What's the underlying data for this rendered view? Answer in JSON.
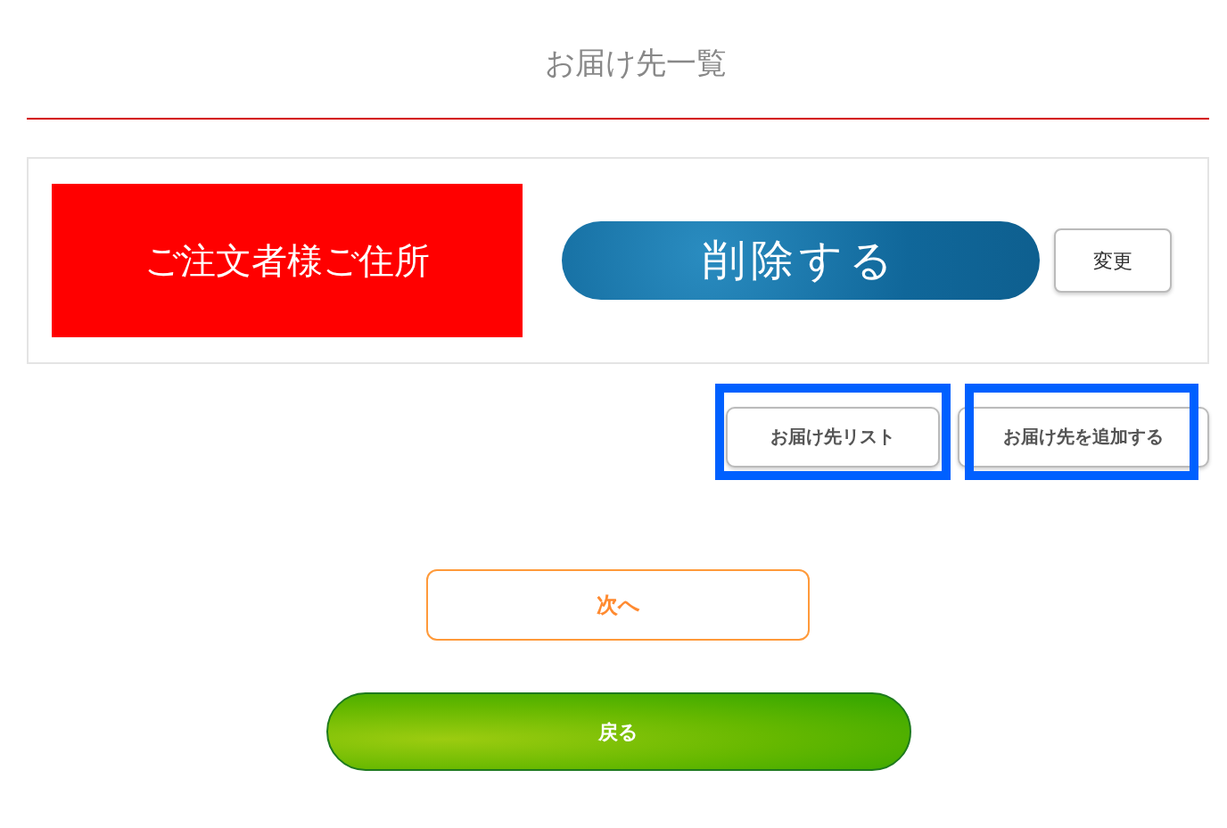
{
  "title": "お届け先一覧",
  "address": {
    "label": "ご注文者様ご住所",
    "delete_button": "削除する",
    "change_button": "変更"
  },
  "actions": [
    {
      "label": "お届け先リスト",
      "highlighted": true
    },
    {
      "label": "お届け先を追加する",
      "highlighted": true
    }
  ],
  "next_button": "次へ",
  "back_button": "戻る"
}
